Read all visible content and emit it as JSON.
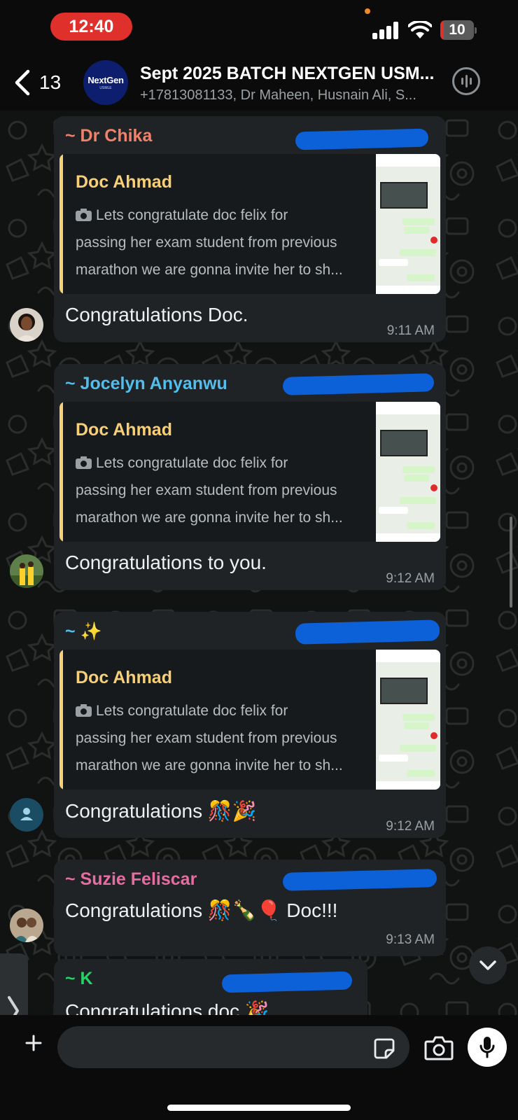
{
  "status_bar": {
    "time": "12:40",
    "battery_level": "10",
    "signal_icon": "cellular-signal-icon",
    "wifi_icon": "wifi-icon"
  },
  "header": {
    "back_icon": "chevron-left-icon",
    "unread_count": "13",
    "group_avatar_text": "NextGen",
    "group_avatar_subtext": "USMLE",
    "title": "Sept  2025 BATCH NEXTGEN USM...",
    "members": "+17813081133, Dr Maheen, Husnain Ali, S...",
    "call_icon": "voice-call-waveform-icon"
  },
  "quoted_message": {
    "author": "Doc Ahmad",
    "line1": "Lets congratulate doc felix for",
    "line2": "passing her exam student from previous",
    "line3": "marathon we are gonna invite her to sh..."
  },
  "messages": [
    {
      "sender": "~ Dr Chika",
      "sender_color": "#f0826b",
      "text": "Congratulations Doc.",
      "time": "9:11 AM"
    },
    {
      "sender": "~ Jocelyn Anyanwu",
      "sender_color": "#53bdeb",
      "text": "Congratulations to you.",
      "time": "9:12 AM"
    },
    {
      "sender": "~ ✨",
      "sender_color": "#53bdeb",
      "text": "Congratulations 🎊🎉",
      "time": "9:12 AM"
    },
    {
      "sender": "~ Suzie Feliscar",
      "sender_color": "#e76ca0",
      "text": "Congratulations 🎊🍾🎈 Doc!!!",
      "time": "9:13 AM"
    },
    {
      "sender": "~ K",
      "sender_color": "#25d366",
      "text": "Congratulations doc 🎉",
      "time": ""
    }
  ],
  "composer": {
    "placeholder": "",
    "plus_icon": "plus-icon",
    "sticker_icon": "sticker-icon",
    "camera_icon": "camera-icon",
    "mic_icon": "microphone-icon"
  },
  "colors": {
    "background": "#0b0b0b",
    "bubble": "#1f2326",
    "quote_accent": "#f7cf76",
    "redaction": "#0c60d8",
    "time_pill": "#e0302b"
  }
}
